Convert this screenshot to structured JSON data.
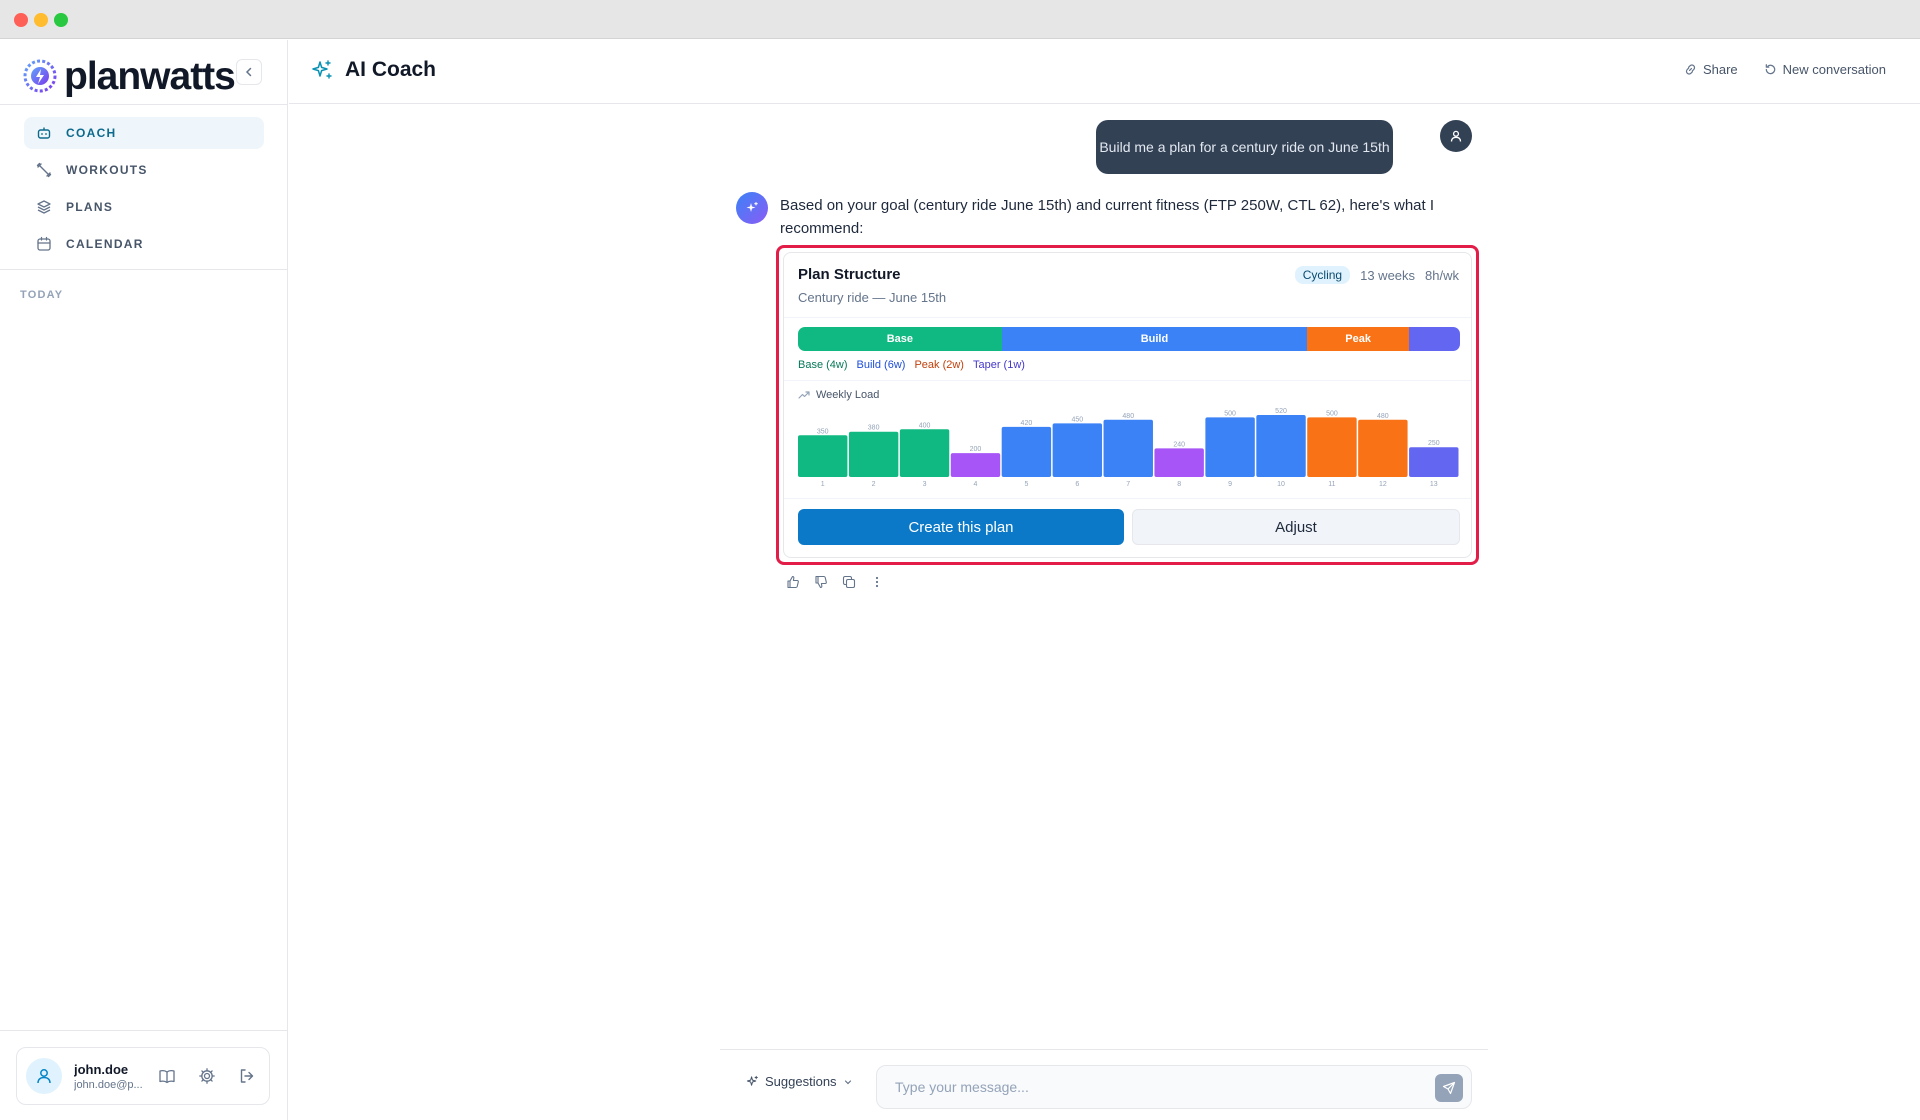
{
  "app": {
    "brand": "planwatts",
    "colors": {
      "accent": "#0b79c7",
      "base": "#10b981",
      "build": "#3b82f6",
      "peak": "#f97316",
      "taper": "#6366f1",
      "recovery": "#a855f7"
    }
  },
  "sidebar": {
    "items": [
      {
        "label": "COACH",
        "icon": "bot-icon",
        "active": true
      },
      {
        "label": "WORKOUTS",
        "icon": "dumbbell-icon",
        "active": false
      },
      {
        "label": "PLANS",
        "icon": "layers-icon",
        "active": false
      },
      {
        "label": "CALENDAR",
        "icon": "calendar-icon",
        "active": false
      }
    ],
    "section_today": "TODAY",
    "user": {
      "name": "john.doe",
      "email": "john.doe@p..."
    }
  },
  "header": {
    "title": "AI Coach",
    "share_label": "Share",
    "new_conversation_label": "New conversation"
  },
  "chat": {
    "user_message": "Build me a plan for a century ride on June 15th",
    "ai_message": "Based on your goal (century ride June 15th) and current fitness (FTP 250W, CTL 62), here's what I recommend:",
    "plan_card": {
      "title": "Plan Structure",
      "subtitle": "Century ride — June 15th",
      "sport_badge": "Cycling",
      "duration": "13 weeks",
      "hours": "8h/wk",
      "phases": [
        {
          "name": "Base",
          "weeks": 4,
          "color": "#10b981",
          "label": "Base"
        },
        {
          "name": "Build",
          "weeks": 6,
          "color": "#3b82f6",
          "label": "Build"
        },
        {
          "name": "Peak",
          "weeks": 2,
          "color": "#f97316",
          "label": "Peak"
        },
        {
          "name": "Taper",
          "weeks": 1,
          "color": "#6366f1",
          "label": ""
        }
      ],
      "legend": [
        {
          "text": "Base (4w)",
          "color": "#047857"
        },
        {
          "text": "Build (6w)",
          "color": "#1d4ed8"
        },
        {
          "text": "Peak (2w)",
          "color": "#c2410c"
        },
        {
          "text": "Taper (1w)",
          "color": "#4338ca"
        }
      ],
      "weekly_load_title": "Weekly Load",
      "create_label": "Create this plan",
      "adjust_label": "Adjust"
    }
  },
  "chart_data": {
    "type": "bar",
    "title": "Weekly Load",
    "categories": [
      "1",
      "2",
      "3",
      "4",
      "5",
      "6",
      "7",
      "8",
      "9",
      "10",
      "11",
      "12",
      "13"
    ],
    "values": [
      350,
      380,
      400,
      200,
      420,
      450,
      480,
      240,
      500,
      520,
      500,
      480,
      250
    ],
    "bar_colors": [
      "#10b981",
      "#10b981",
      "#10b981",
      "#a855f7",
      "#3b82f6",
      "#3b82f6",
      "#3b82f6",
      "#a855f7",
      "#3b82f6",
      "#3b82f6",
      "#f97316",
      "#f97316",
      "#6366f1"
    ],
    "ylim": [
      0,
      520
    ],
    "grid": false,
    "xlabel": "",
    "ylabel": ""
  },
  "composer": {
    "suggestions_label": "Suggestions",
    "placeholder": "Type your message..."
  }
}
